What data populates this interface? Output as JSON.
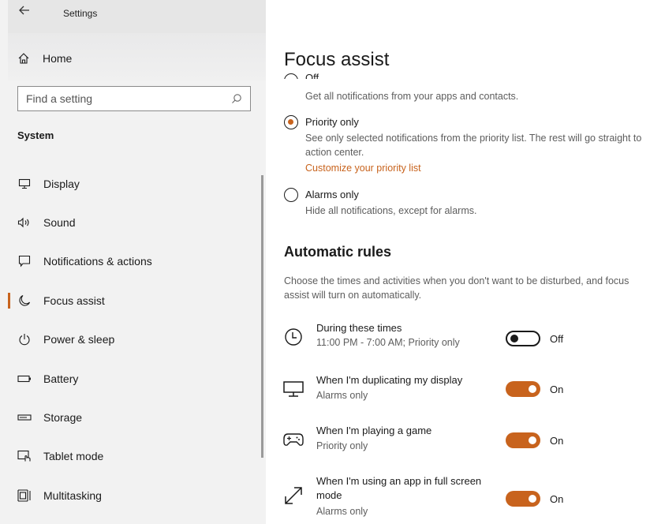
{
  "window": {
    "title": "Settings"
  },
  "sidebar": {
    "home_label": "Home",
    "search_placeholder": "Find a setting",
    "section_heading": "System",
    "items": [
      {
        "label": "Display",
        "icon": "monitor-icon",
        "selected": false
      },
      {
        "label": "Sound",
        "icon": "speaker-icon",
        "selected": false
      },
      {
        "label": "Notifications & actions",
        "icon": "notification-icon",
        "selected": false
      },
      {
        "label": "Focus assist",
        "icon": "moon-icon",
        "selected": true
      },
      {
        "label": "Power & sleep",
        "icon": "power-icon",
        "selected": false
      },
      {
        "label": "Battery",
        "icon": "battery-icon",
        "selected": false
      },
      {
        "label": "Storage",
        "icon": "storage-icon",
        "selected": false
      },
      {
        "label": "Tablet mode",
        "icon": "tablet-mode-icon",
        "selected": false
      },
      {
        "label": "Multitasking",
        "icon": "multitasking-icon",
        "selected": false
      }
    ]
  },
  "main": {
    "title": "Focus assist",
    "options": [
      {
        "label": "Off",
        "description": "Get all notifications from your apps and contacts.",
        "checked": false
      },
      {
        "label": "Priority only",
        "description": "See only selected notifications from the priority list. The rest will go straight to action center.",
        "link": "Customize your priority list",
        "checked": true
      },
      {
        "label": "Alarms only",
        "description": "Hide all notifications, except for alarms.",
        "checked": false
      }
    ],
    "automatic_rules": {
      "heading": "Automatic rules",
      "description": "Choose the times and activities when you don't want to be disturbed, and focus assist will turn on automatically.",
      "rules": [
        {
          "title": "During these times",
          "subtitle": "11:00 PM - 7:00 AM; Priority only",
          "state": "Off",
          "on": false,
          "icon": "clock-icon"
        },
        {
          "title": "When I'm duplicating my display",
          "subtitle": "Alarms only",
          "state": "On",
          "on": true,
          "icon": "monitor-icon"
        },
        {
          "title": "When I'm playing a game",
          "subtitle": "Priority only",
          "state": "On",
          "on": true,
          "icon": "game-controller-icon"
        },
        {
          "title": "When I'm using an app in full screen mode",
          "subtitle": "Alarms only",
          "state": "On",
          "on": true,
          "icon": "fullscreen-icon"
        }
      ]
    }
  },
  "colors": {
    "accent": "#c8631d",
    "sidebar_bg": "#f2f2f2"
  }
}
